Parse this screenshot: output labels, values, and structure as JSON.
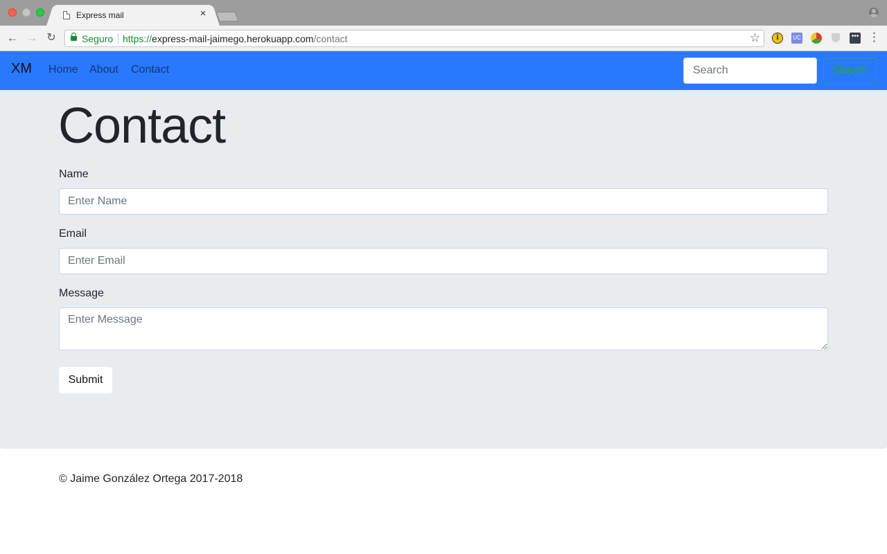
{
  "browser": {
    "tab_title": "Express mail",
    "tab_close_glyph": "×",
    "back_glyph": "←",
    "forward_glyph": "→",
    "reload_glyph": "↻",
    "secure_label": "Seguro",
    "url_scheme": "https://",
    "url_host": "express-mail-jaimego.herokuapp.com",
    "url_path": "/contact",
    "star_glyph": "☆",
    "ext_info_glyph": "i",
    "ext_uc_label": "UC",
    "ext_dots_glyph": "•••",
    "menu_glyph": "⋮",
    "icons": [
      "page-icon",
      "close-icon",
      "back-arrow-icon",
      "forward-arrow-icon",
      "reload-icon",
      "lock-icon",
      "star-icon",
      "info-extension-icon",
      "uc-extension-icon",
      "color-extension-icon",
      "shield-extension-icon",
      "dots-extension-icon",
      "menu-icon",
      "profile-icon"
    ]
  },
  "navbar": {
    "brand": "XM",
    "links": [
      "Home",
      "About",
      "Contact"
    ],
    "search_placeholder": "Search",
    "search_button": "Search",
    "colors": {
      "background": "#2979ff",
      "search_button": "#28a745"
    }
  },
  "main": {
    "title": "Contact",
    "form": {
      "name_label": "Name",
      "name_placeholder": "Enter Name",
      "email_label": "Email",
      "email_placeholder": "Enter Email",
      "message_label": "Message",
      "message_placeholder": "Enter Message",
      "submit_label": "Submit"
    },
    "background_color": "#e9ecef"
  },
  "footer": {
    "text": "© Jaime González Ortega 2017-2018"
  }
}
